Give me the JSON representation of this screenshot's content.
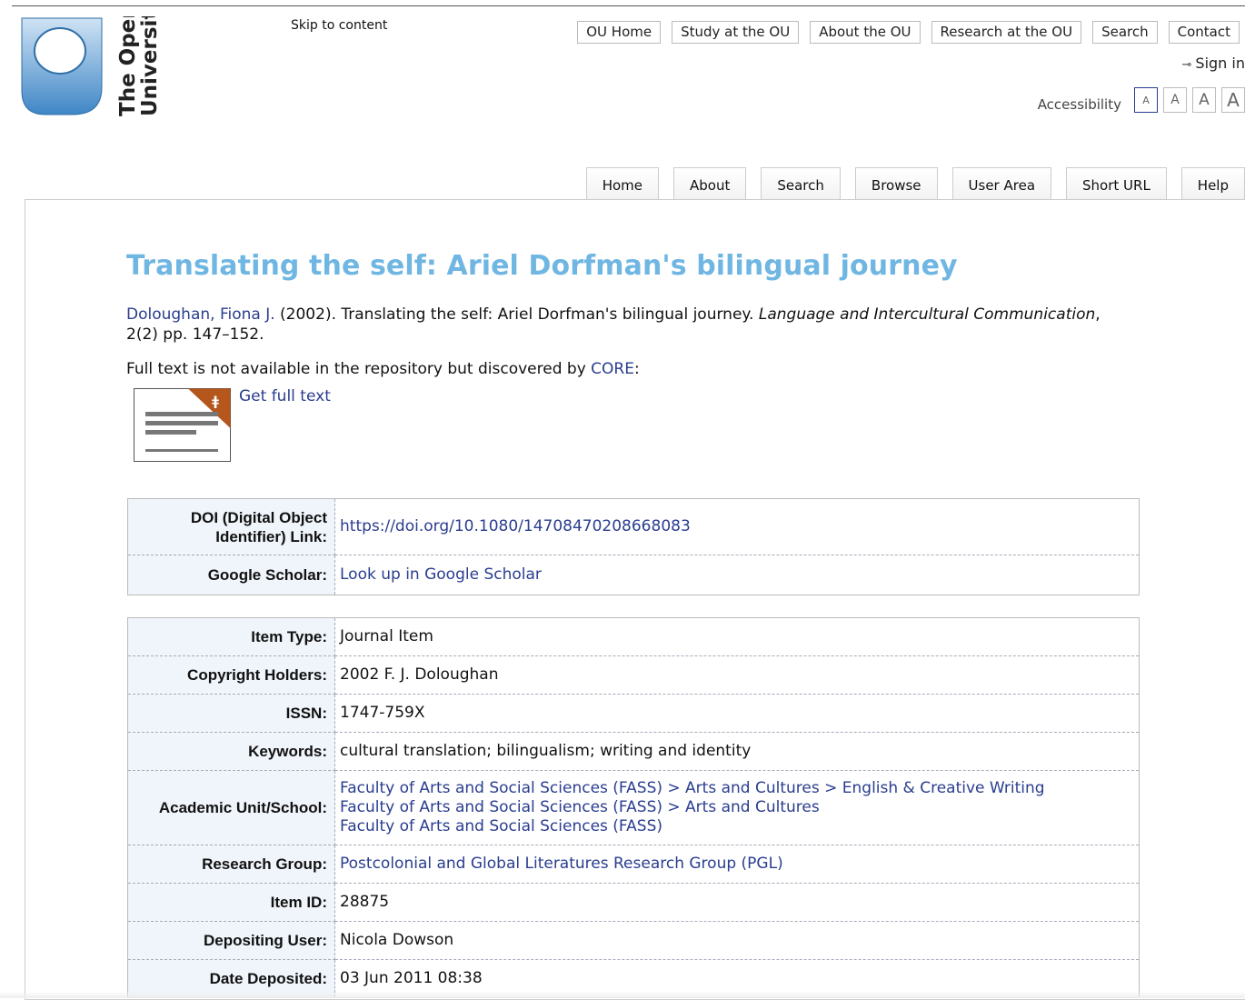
{
  "logo": {
    "text_line1": "The Open",
    "text_line2": "University"
  },
  "skip_link": "Skip to content",
  "top_nav": [
    "OU Home",
    "Study at the OU",
    "About the OU",
    "Research at the OU",
    "Search",
    "Contact"
  ],
  "sign_in": "Sign in",
  "accessibility": {
    "label": "Accessibility",
    "sizes": [
      "A",
      "A",
      "A",
      "A"
    ]
  },
  "tabs": [
    "Home",
    "About",
    "Search",
    "Browse",
    "User Area",
    "Short URL",
    "Help"
  ],
  "title": "Translating the self: Ariel Dorfman's bilingual journey",
  "citation": {
    "author": "Doloughan, Fiona J.",
    "text_before_journal": " (2002). Translating the self: Ariel Dorfman's bilingual journey. ",
    "journal": "Language and Intercultural Communication",
    "text_after_journal": ", 2(2) pp. 147–152."
  },
  "full_text": {
    "text": "Full text is not available in the repository but discovered by ",
    "link": "CORE",
    "suffix": ":"
  },
  "get_full_text": "Get full text",
  "links_table": {
    "doi_label_1": "DOI (Digital Object",
    "doi_label_2": "Identifier) Link:",
    "doi_value": "https://doi.org/10.1080/14708470208668083",
    "scholar_label": "Google Scholar:",
    "scholar_value": "Look up in Google Scholar"
  },
  "details": {
    "item_type_label": "Item Type:",
    "item_type": "Journal Item",
    "copyright_label": "Copyright Holders:",
    "copyright": "2002 F. J. Doloughan",
    "issn_label": "ISSN:",
    "issn": "1747-759X",
    "keywords_label": "Keywords:",
    "keywords": "cultural translation; bilingualism; writing and identity",
    "unit_label": "Academic Unit/School:",
    "units": [
      "Faculty of Arts and Social Sciences (FASS) > Arts and Cultures > English & Creative Writing",
      "Faculty of Arts and Social Sciences (FASS) > Arts and Cultures",
      "Faculty of Arts and Social Sciences (FASS)"
    ],
    "research_group_label": "Research Group:",
    "research_group": "Postcolonial and Global Literatures Research Group (PGL)",
    "item_id_label": "Item ID:",
    "item_id": "28875",
    "depositing_user_label": "Depositing User:",
    "depositing_user": "Nicola Dowson",
    "date_deposited_label": "Date Deposited:",
    "date_deposited": "03 Jun 2011 08:38"
  },
  "colors": {
    "title": "#6fb6e3",
    "link": "#2a3d8f",
    "label_bg": "#f0f5fb",
    "core_corner": "#b5561d"
  }
}
